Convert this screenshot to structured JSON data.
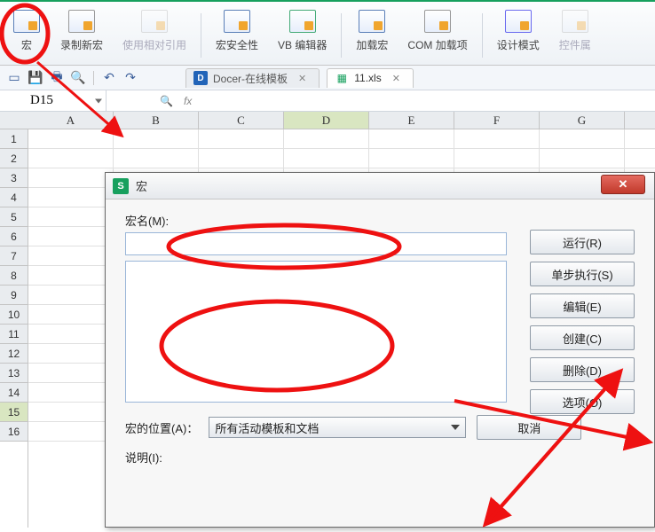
{
  "ribbon": [
    {
      "label": "宏",
      "icon": "macro"
    },
    {
      "label": "录制新宏",
      "icon": "record"
    },
    {
      "label": "使用相对引用",
      "icon": "relative-ref",
      "disabled": true
    },
    {
      "label": "宏安全性",
      "icon": "security"
    },
    {
      "label": "VB 编辑器",
      "icon": "vb-editor"
    },
    {
      "label": "加载宏",
      "icon": "addin"
    },
    {
      "label": "COM 加载项",
      "icon": "com-addin"
    },
    {
      "label": "设计模式",
      "icon": "design-mode"
    },
    {
      "label": "控件属",
      "icon": "properties",
      "disabled": true
    }
  ],
  "tabs": [
    {
      "label": "Docer-在线模板",
      "icon": "docer",
      "active": false
    },
    {
      "label": "11.xls",
      "icon": "xls",
      "active": true
    }
  ],
  "namebox": "D15",
  "fx": {
    "q": "🔍",
    "fx": "fx"
  },
  "columns": [
    "A",
    "B",
    "C",
    "D",
    "E",
    "F",
    "G"
  ],
  "rows": [
    1,
    2,
    3,
    4,
    5,
    6,
    7,
    8,
    9,
    10,
    11,
    12,
    13,
    14,
    15,
    16
  ],
  "selectedRow": 15,
  "selectedCol": "D",
  "dialog": {
    "title": "宏",
    "macro_name_label": "宏名(M):",
    "macro_name_value": "",
    "location_label": "宏的位置(A)：",
    "location_value": "所有活动模板和文档",
    "description_label": "说明(I):",
    "buttons": {
      "run": "运行(R)",
      "step": "单步执行(S)",
      "edit": "编辑(E)",
      "create": "创建(C)",
      "delete": "删除(D)",
      "options": "选项(O)",
      "cancel": "取消"
    }
  }
}
